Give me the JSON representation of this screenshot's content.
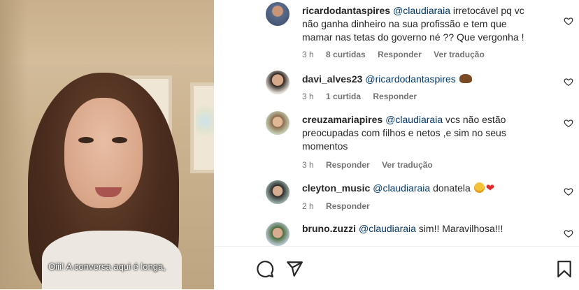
{
  "video": {
    "subtitle": "Oiii! A conversa aqui é longa,"
  },
  "comments": [
    {
      "username": "ricardodantaspires",
      "mention": "@claudiaraia",
      "text": " irretocável pq vc não ganha dinheiro na sua profissão e tem que mamar nas tetas do governo né ?? Que vergonha !",
      "time": "3 h",
      "likes": "8 curtidas",
      "reply": "Responder",
      "translate": "Ver tradução",
      "emoji": ""
    },
    {
      "username": "davi_alves23",
      "mention": "@ricardodantaspires",
      "text": " ",
      "time": "3 h",
      "likes": "1 curtida",
      "reply": "Responder",
      "translate": "",
      "emoji": "bear"
    },
    {
      "username": "creuzamariapires",
      "mention": "@claudiaraia",
      "text": " vcs não estão preocupadas com filhos e netos ,e sim no seus momentos",
      "time": "3 h",
      "likes": "",
      "reply": "Responder",
      "translate": "Ver tradução",
      "emoji": ""
    },
    {
      "username": "cleyton_music",
      "mention": "@claudiaraia",
      "text": " donatela ",
      "time": "2 h",
      "likes": "",
      "reply": "Responder",
      "translate": "",
      "emoji": "star-struck, red-heart"
    },
    {
      "username": "bruno.zuzzi",
      "mention": "@claudiaraia",
      "text": " sim!! Maravilhosa!!!",
      "time": "",
      "likes": "",
      "reply": "",
      "translate": "",
      "emoji": ""
    }
  ],
  "icons": {
    "heart": "heart-outline-icon",
    "comment": "comment-icon",
    "share": "share-icon",
    "save": "bookmark-icon"
  },
  "colors": {
    "mention": "#00376b",
    "meta": "#737373",
    "text": "#262626"
  }
}
